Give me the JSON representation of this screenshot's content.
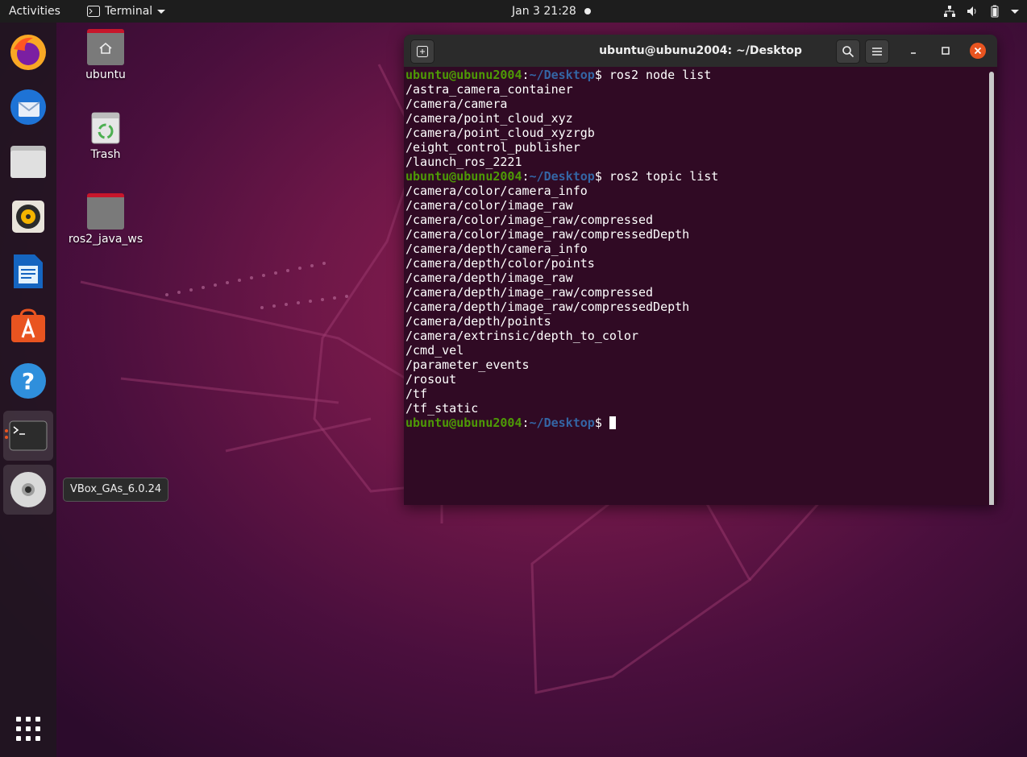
{
  "topbar": {
    "activities": "Activities",
    "app_menu": "Terminal",
    "clock": "Jan 3  21:28"
  },
  "desktop": {
    "icons": [
      {
        "label": "ubuntu"
      },
      {
        "label": "Trash"
      },
      {
        "label": "ros2_java_ws"
      }
    ],
    "tooltip": "VBox_GAs_6.0.24"
  },
  "terminal": {
    "title": "ubuntu@ubunu2004: ~/Desktop",
    "prompt_user": "ubuntu@ubunu2004",
    "prompt_sep": ":",
    "prompt_path": "~/Desktop",
    "prompt_dollar": "$",
    "cmd1": " ros2 node list",
    "node_list": [
      "/astra_camera_container",
      "/camera/camera",
      "/camera/point_cloud_xyz",
      "/camera/point_cloud_xyzrgb",
      "/eight_control_publisher",
      "/launch_ros_2221"
    ],
    "cmd2": " ros2 topic list",
    "topic_list": [
      "/camera/color/camera_info",
      "/camera/color/image_raw",
      "/camera/color/image_raw/compressed",
      "/camera/color/image_raw/compressedDepth",
      "/camera/depth/camera_info",
      "/camera/depth/color/points",
      "/camera/depth/image_raw",
      "/camera/depth/image_raw/compressed",
      "/camera/depth/image_raw/compressedDepth",
      "/camera/depth/points",
      "/camera/extrinsic/depth_to_color",
      "/cmd_vel",
      "/parameter_events",
      "/rosout",
      "/tf",
      "/tf_static"
    ]
  },
  "dock": {
    "items": [
      {
        "icon": "firefox-icon"
      },
      {
        "icon": "thunderbird-icon"
      },
      {
        "icon": "files-icon"
      },
      {
        "icon": "rhythmbox-icon"
      },
      {
        "icon": "libreoffice-writer-icon"
      },
      {
        "icon": "software-center-icon"
      },
      {
        "icon": "help-icon"
      },
      {
        "icon": "terminal-icon"
      },
      {
        "icon": "optical-disc-icon"
      },
      {
        "icon": "show-applications-icon"
      }
    ]
  },
  "colors": {
    "terminal_bg": "#300a24",
    "prompt_user": "#4e9a06",
    "prompt_path": "#3465a4",
    "accent": "#e95420"
  }
}
